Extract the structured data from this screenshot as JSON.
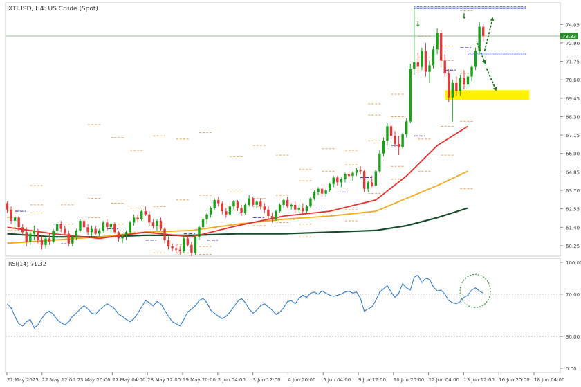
{
  "chart_title": "XTIUSD, H4:  US Crude (Spot)",
  "rsi_label": "RSI(14) 71.32",
  "colors": {
    "bull": "#19a119",
    "bear": "#e23b3b",
    "ma_fast": "#e8302a",
    "ma_mid": "#f4a81e",
    "ma_slow": "#174d2a",
    "rsi": "#2b7bd3",
    "zone": "#fff200",
    "level": "#e7a35a",
    "price_line": "#8fbf8f",
    "price_tag": "#2f8f2f"
  },
  "chart_data": [
    {
      "type": "candlestick",
      "y_ticks": [
        "74.05",
        "72.90",
        "71.75",
        "70.60",
        "69.45",
        "68.30",
        "67.15",
        "66.00",
        "64.85",
        "63.70",
        "62.55",
        "61.40",
        "60.25"
      ],
      "ylim": [
        59.6,
        75.4
      ],
      "current_price": "73.33",
      "current_price_value": 73.33,
      "x_ticks": [
        "21 May 2025",
        "22 May 12:00",
        "23 May 20:00",
        "27 May 04:00",
        "28 May 12:00",
        "29 May 20:00",
        "2 Jun 04:00",
        "3 Jun 12:00",
        "4 Jun 20:00",
        "6 Jun 04:00",
        "9 Jun 12:00",
        "10 Jun 20:00",
        "12 Jun 04:00",
        "13 Jun 12:00",
        "16 Jun 20:00",
        "18 Jun 04:00"
      ],
      "candles": [
        [
          62.9,
          63.0,
          62.3,
          62.5
        ],
        [
          62.5,
          62.7,
          61.6,
          61.8
        ],
        [
          61.8,
          62.2,
          61.3,
          62.0
        ],
        [
          62.0,
          62.1,
          61.2,
          61.4
        ],
        [
          61.4,
          61.6,
          60.9,
          61.1
        ],
        [
          61.1,
          61.4,
          60.2,
          60.5
        ],
        [
          60.5,
          61.2,
          60.3,
          61.0
        ],
        [
          61.0,
          61.5,
          60.6,
          61.2
        ],
        [
          61.2,
          61.3,
          60.4,
          60.6
        ],
        [
          60.6,
          60.9,
          60.0,
          60.3
        ],
        [
          60.3,
          60.8,
          60.1,
          60.7
        ],
        [
          60.7,
          61.0,
          60.3,
          60.5
        ],
        [
          60.5,
          61.3,
          60.4,
          61.2
        ],
        [
          61.2,
          61.7,
          61.0,
          61.6
        ],
        [
          61.6,
          61.8,
          61.1,
          61.3
        ],
        [
          61.3,
          61.5,
          60.9,
          61.0
        ],
        [
          61.0,
          61.2,
          60.2,
          60.4
        ],
        [
          60.4,
          60.9,
          60.2,
          60.8
        ],
        [
          60.8,
          61.3,
          60.6,
          61.2
        ],
        [
          61.2,
          61.9,
          61.1,
          61.8
        ],
        [
          61.8,
          62.0,
          61.2,
          61.4
        ],
        [
          61.4,
          61.6,
          60.9,
          61.1
        ],
        [
          61.1,
          61.5,
          60.8,
          61.3
        ],
        [
          61.3,
          61.5,
          60.9,
          61.0
        ],
        [
          61.0,
          61.3,
          60.8,
          61.2
        ],
        [
          61.2,
          61.8,
          61.1,
          61.7
        ],
        [
          61.7,
          61.9,
          61.2,
          61.4
        ],
        [
          61.4,
          61.7,
          61.0,
          61.6
        ],
        [
          61.6,
          61.7,
          61.0,
          61.1
        ],
        [
          61.1,
          61.2,
          60.5,
          60.7
        ],
        [
          60.7,
          61.0,
          60.4,
          60.9
        ],
        [
          60.9,
          61.2,
          60.6,
          61.1
        ],
        [
          61.1,
          61.8,
          61.0,
          61.7
        ],
        [
          61.7,
          62.2,
          61.5,
          62.0
        ],
        [
          62.0,
          62.2,
          61.7,
          61.9
        ],
        [
          61.9,
          62.5,
          61.8,
          62.4
        ],
        [
          62.4,
          62.7,
          62.1,
          62.2
        ],
        [
          62.2,
          62.4,
          61.5,
          61.7
        ],
        [
          61.7,
          61.9,
          61.3,
          61.5
        ],
        [
          61.5,
          61.9,
          61.2,
          61.8
        ],
        [
          61.8,
          62.0,
          61.2,
          61.3
        ],
        [
          61.3,
          61.4,
          60.4,
          60.6
        ],
        [
          60.6,
          60.9,
          60.0,
          60.2
        ],
        [
          60.2,
          60.4,
          59.9,
          60.1
        ],
        [
          60.1,
          60.3,
          59.8,
          60.0
        ],
        [
          60.0,
          60.2,
          59.7,
          59.9
        ],
        [
          59.9,
          60.9,
          59.8,
          60.7
        ],
        [
          60.7,
          60.9,
          60.2,
          60.3
        ],
        [
          60.3,
          60.5,
          59.6,
          59.8
        ],
        [
          59.8,
          60.9,
          59.7,
          60.8
        ],
        [
          60.8,
          61.5,
          60.6,
          61.4
        ],
        [
          61.4,
          62.0,
          61.3,
          61.9
        ],
        [
          61.9,
          62.3,
          61.6,
          62.2
        ],
        [
          62.2,
          62.7,
          62.0,
          62.6
        ],
        [
          62.6,
          63.2,
          62.5,
          63.1
        ],
        [
          63.1,
          63.3,
          62.7,
          62.9
        ],
        [
          62.9,
          63.0,
          62.2,
          62.4
        ],
        [
          62.4,
          62.6,
          62.0,
          62.2
        ],
        [
          62.2,
          62.9,
          62.1,
          62.7
        ],
        [
          62.7,
          63.1,
          62.5,
          63.0
        ],
        [
          63.0,
          63.1,
          62.4,
          62.6
        ],
        [
          62.6,
          62.8,
          62.1,
          62.3
        ],
        [
          62.3,
          62.9,
          62.2,
          62.8
        ],
        [
          62.8,
          63.4,
          62.7,
          63.2
        ],
        [
          63.2,
          63.3,
          62.7,
          62.8
        ],
        [
          62.8,
          63.1,
          62.6,
          63.0
        ],
        [
          63.0,
          63.2,
          62.5,
          62.7
        ],
        [
          62.7,
          62.9,
          62.3,
          62.5
        ],
        [
          62.5,
          62.7,
          61.9,
          62.1
        ],
        [
          62.1,
          62.3,
          61.7,
          61.9
        ],
        [
          61.9,
          62.5,
          61.8,
          62.4
        ],
        [
          62.4,
          62.9,
          62.3,
          62.8
        ],
        [
          62.8,
          63.2,
          62.6,
          63.1
        ],
        [
          63.1,
          63.3,
          62.6,
          62.7
        ],
        [
          62.7,
          62.9,
          62.5,
          62.8
        ],
        [
          62.8,
          63.0,
          62.3,
          62.5
        ],
        [
          62.5,
          62.8,
          62.3,
          62.6
        ],
        [
          62.6,
          62.9,
          62.2,
          62.4
        ],
        [
          62.4,
          62.8,
          62.3,
          62.7
        ],
        [
          62.7,
          63.3,
          62.6,
          63.2
        ],
        [
          63.2,
          63.7,
          63.1,
          63.6
        ],
        [
          63.6,
          63.9,
          63.4,
          63.8
        ],
        [
          63.8,
          63.9,
          63.3,
          63.5
        ],
        [
          63.5,
          63.8,
          63.3,
          63.7
        ],
        [
          63.7,
          64.2,
          63.6,
          64.1
        ],
        [
          64.1,
          64.6,
          63.9,
          64.5
        ],
        [
          64.5,
          64.6,
          64.0,
          64.2
        ],
        [
          64.2,
          64.5,
          63.9,
          64.4
        ],
        [
          64.4,
          64.8,
          64.2,
          64.7
        ],
        [
          64.7,
          64.9,
          64.4,
          64.6
        ],
        [
          64.6,
          64.9,
          64.3,
          64.8
        ],
        [
          64.8,
          65.1,
          64.6,
          65.0
        ],
        [
          65.0,
          65.2,
          64.7,
          64.9
        ],
        [
          64.9,
          65.0,
          63.6,
          63.8
        ],
        [
          63.8,
          64.3,
          63.6,
          64.2
        ],
        [
          64.2,
          64.6,
          63.9,
          64.0
        ],
        [
          64.0,
          65.0,
          63.9,
          64.9
        ],
        [
          64.9,
          66.2,
          64.8,
          66.0
        ],
        [
          66.0,
          67.0,
          65.8,
          66.8
        ],
        [
          66.8,
          67.9,
          66.5,
          67.7
        ],
        [
          67.7,
          67.9,
          66.9,
          67.1
        ],
        [
          67.1,
          67.4,
          66.4,
          66.6
        ],
        [
          66.6,
          67.1,
          65.9,
          66.4
        ],
        [
          66.4,
          67.3,
          66.3,
          67.2
        ],
        [
          67.2,
          68.2,
          67.0,
          68.0
        ],
        [
          68.0,
          71.6,
          67.9,
          71.3
        ],
        [
          71.3,
          75.1,
          70.9,
          71.7
        ],
        [
          71.7,
          72.3,
          71.0,
          71.4
        ],
        [
          71.4,
          72.6,
          71.2,
          72.4
        ],
        [
          72.4,
          72.9,
          70.8,
          71.1
        ],
        [
          71.1,
          71.8,
          70.4,
          71.5
        ],
        [
          71.5,
          72.7,
          71.3,
          72.5
        ],
        [
          72.5,
          73.8,
          72.2,
          73.5
        ],
        [
          73.5,
          73.7,
          71.4,
          71.8
        ],
        [
          71.8,
          72.2,
          70.8,
          71.0
        ],
        [
          71.0,
          71.3,
          69.2,
          69.5
        ],
        [
          69.5,
          70.6,
          68.0,
          70.4
        ],
        [
          70.4,
          70.8,
          69.6,
          69.9
        ],
        [
          69.9,
          70.9,
          69.6,
          70.7
        ],
        [
          70.7,
          71.2,
          70.0,
          70.3
        ],
        [
          70.3,
          71.0,
          70.0,
          70.8
        ],
        [
          70.8,
          71.5,
          70.5,
          71.4
        ],
        [
          71.4,
          72.6,
          71.2,
          72.4
        ],
        [
          72.4,
          74.2,
          72.2,
          73.9
        ],
        [
          73.9,
          74.1,
          73.0,
          73.33
        ]
      ],
      "ma_fast_points": [
        [
          0,
          61.4
        ],
        [
          12,
          61.0
        ],
        [
          24,
          60.7
        ],
        [
          36,
          61.1
        ],
        [
          48,
          60.8
        ],
        [
          60,
          61.5
        ],
        [
          72,
          62.1
        ],
        [
          84,
          62.4
        ],
        [
          96,
          63.1
        ],
        [
          104,
          64.6
        ],
        [
          112,
          66.5
        ],
        [
          120,
          67.7
        ]
      ],
      "ma_mid_points": [
        [
          0,
          60.4
        ],
        [
          12,
          60.6
        ],
        [
          24,
          60.8
        ],
        [
          36,
          61.1
        ],
        [
          48,
          61.2
        ],
        [
          60,
          61.6
        ],
        [
          72,
          61.9
        ],
        [
          84,
          62.1
        ],
        [
          96,
          62.4
        ],
        [
          104,
          63.2
        ],
        [
          112,
          64.0
        ],
        [
          120,
          64.9
        ]
      ],
      "ma_slow_points": [
        [
          0,
          61.0
        ],
        [
          12,
          60.8
        ],
        [
          24,
          60.8
        ],
        [
          36,
          60.9
        ],
        [
          48,
          60.9
        ],
        [
          60,
          61.0
        ],
        [
          72,
          61.0
        ],
        [
          84,
          61.1
        ],
        [
          96,
          61.2
        ],
        [
          104,
          61.5
        ],
        [
          112,
          62.0
        ],
        [
          120,
          62.6
        ]
      ],
      "levels": [
        {
          "idx": 0,
          "prices": [
            62.45,
            62.0,
            61.2,
            60.45
          ]
        },
        {
          "idx": 6,
          "prices": [
            64.0,
            62.8,
            62.3
          ]
        },
        {
          "idx": 14,
          "prices": [
            62.8,
            61.6,
            60.4
          ]
        },
        {
          "idx": 21,
          "prices": [
            67.8,
            63.2,
            62.0
          ]
        },
        {
          "idx": 27,
          "prices": [
            67.0,
            62.9,
            61.6
          ]
        },
        {
          "idx": 32,
          "prices": [
            66.2,
            62.6,
            61.1
          ]
        },
        {
          "idx": 38,
          "prices": [
            67.1,
            62.7,
            61.6,
            59.8
          ]
        },
        {
          "idx": 44,
          "prices": [
            66.9,
            63.1,
            60.3,
            59.8
          ]
        },
        {
          "idx": 50,
          "prices": [
            67.3,
            63.4,
            60.2,
            59.7
          ]
        },
        {
          "idx": 58,
          "prices": [
            65.8,
            63.6,
            61.0
          ]
        },
        {
          "idx": 64,
          "prices": [
            66.5,
            63.2,
            62.7,
            61.5
          ]
        },
        {
          "idx": 70,
          "prices": [
            65.9,
            63.4,
            61.7
          ]
        },
        {
          "idx": 76,
          "prices": [
            65.0,
            64.3,
            61.6,
            60.8
          ]
        },
        {
          "idx": 82,
          "prices": [
            66.3,
            64.9,
            62.1,
            61.1
          ]
        },
        {
          "idx": 88,
          "prices": [
            66.2,
            65.3,
            62.5,
            61.8
          ]
        },
        {
          "idx": 94,
          "prices": [
            69.1,
            68.4,
            66.8,
            63.5
          ]
        },
        {
          "idx": 100,
          "prices": [
            69.7,
            68.3,
            65.2,
            64.4
          ]
        },
        {
          "idx": 107,
          "prices": [
            73.3,
            72.0,
            66.9,
            64.9
          ]
        },
        {
          "idx": 113,
          "prices": [
            72.7,
            71.8,
            67.7,
            65.9
          ]
        },
        {
          "idx": 118,
          "prices": [
            74.9,
            71.0,
            68.0,
            63.8
          ]
        }
      ],
      "dashes": [
        [
          2,
          62.4
        ],
        [
          12,
          61.6
        ],
        [
          26,
          61.3
        ],
        [
          36,
          60.6
        ],
        [
          46,
          61.0
        ],
        [
          52,
          60.6
        ],
        [
          58,
          62.3
        ],
        [
          64,
          62.0
        ],
        [
          72,
          61.9
        ],
        [
          80,
          62.6
        ],
        [
          86,
          63.6
        ],
        [
          92,
          64.5
        ],
        [
          100,
          66.5
        ],
        [
          106,
          67.1
        ],
        [
          114,
          71.2
        ],
        [
          118,
          72.6
        ]
      ],
      "zone": {
        "from_idx": 114,
        "to_idx": 136,
        "price_top": 69.95,
        "price_bottom": 69.35
      },
      "tops": [
        {
          "from_idx": 106,
          "to_idx": 135,
          "price": 75.1
        },
        {
          "from_idx": 120,
          "to_idx": 135,
          "price": 72.2
        }
      ]
    },
    {
      "type": "line",
      "name": "RSI",
      "y_ticks": [
        "100.00",
        "70.00",
        "30.00",
        "0.00"
      ],
      "ylim": [
        0,
        100
      ],
      "levels": [
        70,
        30
      ],
      "values": [
        61,
        57,
        49,
        42,
        40,
        44,
        46,
        38,
        41,
        47,
        52,
        54,
        51,
        46,
        43,
        41,
        44,
        49,
        52,
        56,
        59,
        56,
        52,
        51,
        55,
        58,
        61,
        59,
        56,
        51,
        49,
        46,
        44,
        47,
        52,
        58,
        64,
        62,
        59,
        63,
        61,
        55,
        49,
        44,
        42,
        40,
        46,
        53,
        56,
        59,
        64,
        66,
        62,
        55,
        52,
        49,
        47,
        49,
        53,
        58,
        63,
        66,
        62,
        56,
        52,
        55,
        59,
        61,
        58,
        55,
        51,
        53,
        57,
        63,
        64,
        61,
        66,
        69,
        67,
        71,
        72,
        70,
        73,
        71,
        69,
        68,
        69,
        70,
        72,
        73,
        71,
        72,
        66,
        54,
        56,
        58,
        64,
        72,
        75,
        78,
        72,
        67,
        71,
        80,
        76,
        74,
        86,
        88,
        81,
        85,
        84,
        77,
        73,
        74,
        70,
        64,
        62,
        61,
        63,
        67,
        69,
        74,
        76,
        73,
        71
      ]
    }
  ]
}
